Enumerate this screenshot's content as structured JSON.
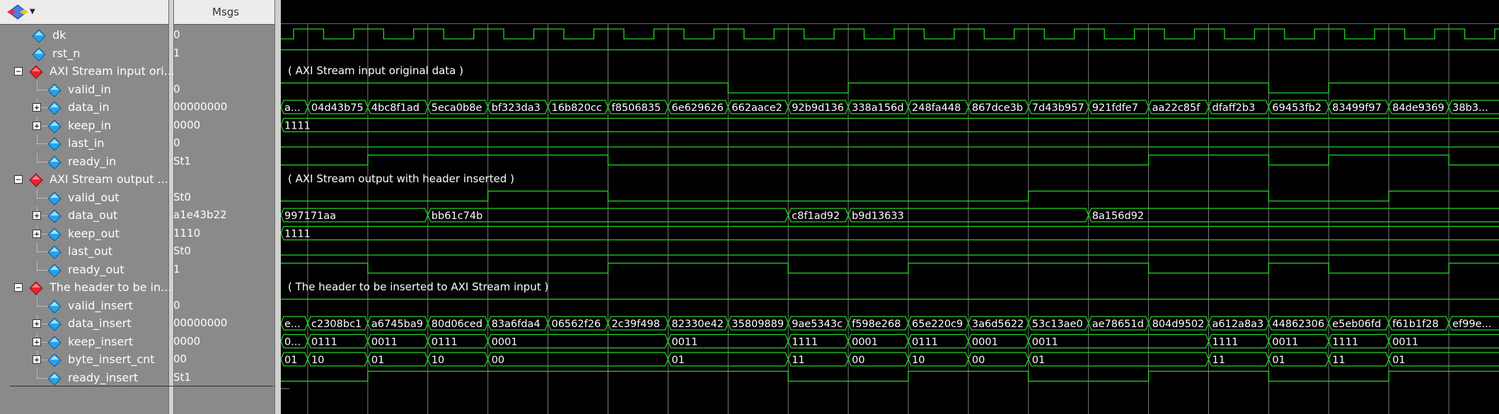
{
  "header": {
    "msgs_label": "Msgs"
  },
  "signals": [
    {
      "name": "dk",
      "value": "0",
      "level": 1,
      "icon": "blue",
      "expand": null,
      "wave": "clk"
    },
    {
      "name": "rst_n",
      "value": "1",
      "level": 1,
      "icon": "blue",
      "expand": null,
      "wave": "const1"
    },
    {
      "name": "AXI Stream input ori...",
      "value": "",
      "level": 0,
      "icon": "red",
      "expand": "-",
      "wave": "group",
      "group_label": "( AXI Stream input original data )"
    },
    {
      "name": "valid_in",
      "value": "0",
      "level": 2,
      "icon": "blue",
      "expand": null,
      "wave": "bit"
    },
    {
      "name": "data_in",
      "value": "00000000",
      "level": 2,
      "icon": "blue",
      "expand": "+",
      "wave": "bus"
    },
    {
      "name": "keep_in",
      "value": "0000",
      "level": 2,
      "icon": "blue",
      "expand": "+",
      "wave": "bus"
    },
    {
      "name": "last_in",
      "value": "0",
      "level": 2,
      "icon": "blue",
      "expand": null,
      "wave": "bit"
    },
    {
      "name": "ready_in",
      "value": "St1",
      "level": 2,
      "icon": "blue",
      "expand": null,
      "wave": "bit"
    },
    {
      "name": "AXI Stream output ...",
      "value": "",
      "level": 0,
      "icon": "red",
      "expand": "-",
      "wave": "group",
      "group_label": "( AXI Stream output with header inserted )"
    },
    {
      "name": "valid_out",
      "value": "St0",
      "level": 2,
      "icon": "blue",
      "expand": null,
      "wave": "bit"
    },
    {
      "name": "data_out",
      "value": "a1e43b22",
      "level": 2,
      "icon": "blue",
      "expand": "+",
      "wave": "bus"
    },
    {
      "name": "keep_out",
      "value": "1110",
      "level": 2,
      "icon": "blue",
      "expand": "+",
      "wave": "bus"
    },
    {
      "name": "last_out",
      "value": "St0",
      "level": 2,
      "icon": "blue",
      "expand": null,
      "wave": "bit"
    },
    {
      "name": "ready_out",
      "value": "1",
      "level": 2,
      "icon": "blue",
      "expand": null,
      "wave": "bit"
    },
    {
      "name": "The header to be in...",
      "value": "",
      "level": 0,
      "icon": "red",
      "expand": "-",
      "wave": "group",
      "group_label": "( The header to be inserted to AXI Stream input )"
    },
    {
      "name": "valid_insert",
      "value": "0",
      "level": 2,
      "icon": "blue",
      "expand": null,
      "wave": "bit"
    },
    {
      "name": "data_insert",
      "value": "00000000",
      "level": 2,
      "icon": "blue",
      "expand": "+",
      "wave": "bus"
    },
    {
      "name": "keep_insert",
      "value": "0000",
      "level": 2,
      "icon": "blue",
      "expand": "+",
      "wave": "bus"
    },
    {
      "name": "byte_insert_cnt",
      "value": "00",
      "level": 2,
      "icon": "blue",
      "expand": "+",
      "wave": "bus"
    },
    {
      "name": "ready_insert",
      "value": "St1",
      "level": 2,
      "icon": "blue",
      "expand": null,
      "wave": "bit"
    }
  ],
  "waves": {
    "valid_in": [
      1,
      1,
      1,
      1,
      1,
      1,
      1,
      1,
      0,
      0,
      1,
      1,
      1,
      1,
      1,
      1,
      1,
      0,
      1,
      1,
      1,
      1,
      1,
      0
    ],
    "last_in": [
      0,
      0,
      0,
      0,
      0,
      0,
      0,
      0,
      0,
      0,
      0,
      0,
      0,
      0,
      0,
      0,
      0,
      0,
      0,
      0,
      0,
      0,
      0,
      0
    ],
    "ready_in": [
      0,
      0,
      1,
      1,
      1,
      1,
      0,
      0,
      0,
      0,
      0,
      0,
      0,
      0,
      0,
      1,
      1,
      0,
      1,
      1,
      0,
      0,
      1,
      1
    ],
    "valid_out": [
      0,
      0,
      0,
      0,
      1,
      1,
      0,
      0,
      0,
      0,
      0,
      0,
      0,
      1,
      1,
      1,
      1,
      0,
      0,
      1,
      1,
      0,
      0,
      0
    ],
    "last_out": [
      0,
      0,
      0,
      0,
      0,
      0,
      0,
      0,
      0,
      0,
      0,
      0,
      0,
      0,
      0,
      0,
      0,
      0,
      0,
      0,
      0,
      0,
      0,
      0
    ],
    "ready_out": [
      1,
      1,
      0,
      0,
      0,
      0,
      1,
      1,
      1,
      0,
      0,
      1,
      1,
      1,
      1,
      0,
      0,
      1,
      0,
      0,
      1,
      1,
      0,
      0
    ],
    "valid_insert": [
      1,
      1,
      1,
      1,
      1,
      1,
      1,
      1,
      1,
      1,
      1,
      1,
      1,
      1,
      1,
      1,
      1,
      1,
      1,
      1,
      1,
      1,
      1,
      1
    ],
    "ready_insert": [
      0,
      0,
      1,
      1,
      1,
      1,
      1,
      1,
      1,
      0,
      0,
      1,
      1,
      0,
      0,
      1,
      1,
      0,
      0,
      1,
      1,
      0,
      0,
      1
    ]
  },
  "buses": {
    "data_in": [
      "a...",
      "04d43b75",
      "4bc8f1ad",
      "5eca0b8e",
      "bf323da3",
      "16b820cc",
      "f8506835",
      "6e629626",
      "662aace2",
      "92b9d136",
      "338a156d",
      "248fa448",
      "867dce3b",
      "7d43b957",
      "921fdfe7",
      "aa22c85f",
      "dfaff2b3",
      "69453fb2",
      "83499f97",
      "84de9369",
      "38b3..."
    ],
    "keep_in": [
      "1111"
    ],
    "data_out": [
      "997171aa",
      "bb61c74b",
      "c8f1ad92",
      "b9d13633",
      "8a156d92"
    ],
    "keep_out": [
      "1111"
    ],
    "data_insert": [
      "e...",
      "c2308bc1",
      "a6745ba9",
      "80d06ced",
      "83a6fda4",
      "06562f26",
      "2c39f498",
      "82330e42",
      "35809889",
      "9ae5343c",
      "f598e268",
      "65e220c9",
      "3a6d5622",
      "53c13ae0",
      "ae78651d",
      "804d9502",
      "a612a8a3",
      "44862306",
      "e5eb06fd",
      "f61b1f28",
      "ef99e..."
    ],
    "keep_insert": [
      "0...",
      "0111",
      "0011",
      "0111",
      "0001",
      "0011",
      "1111",
      "0001",
      "0111",
      "0001",
      "0011",
      "1111",
      "0011",
      "1111",
      "0011"
    ],
    "byte_insert_cnt": [
      "01",
      "10",
      "01",
      "10",
      "00",
      "01",
      "11",
      "00",
      "10",
      "00",
      "01",
      "11",
      "01",
      "11",
      "01"
    ]
  },
  "colors": {
    "wave": "#22d622",
    "grid": "#7a7a7a",
    "text": "#ffffff"
  }
}
